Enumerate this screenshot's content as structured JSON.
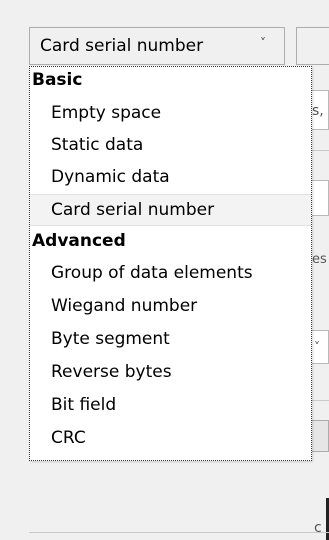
{
  "combo": {
    "selected_value": "Card serial number",
    "chevron_glyph": "˅"
  },
  "dropdown": {
    "groups": [
      {
        "header": "Basic",
        "items": [
          "Empty space",
          "Static data",
          "Dynamic data",
          "Card serial number"
        ]
      },
      {
        "header": "Advanced",
        "items": [
          "Group of data elements",
          "Wiegand number",
          "Byte segment",
          "Reverse bytes",
          "Bit field",
          "CRC"
        ]
      }
    ],
    "selected_item": "Card serial number"
  },
  "background": {
    "fragments": [
      "s,",
      "es",
      "˅",
      "c"
    ]
  }
}
